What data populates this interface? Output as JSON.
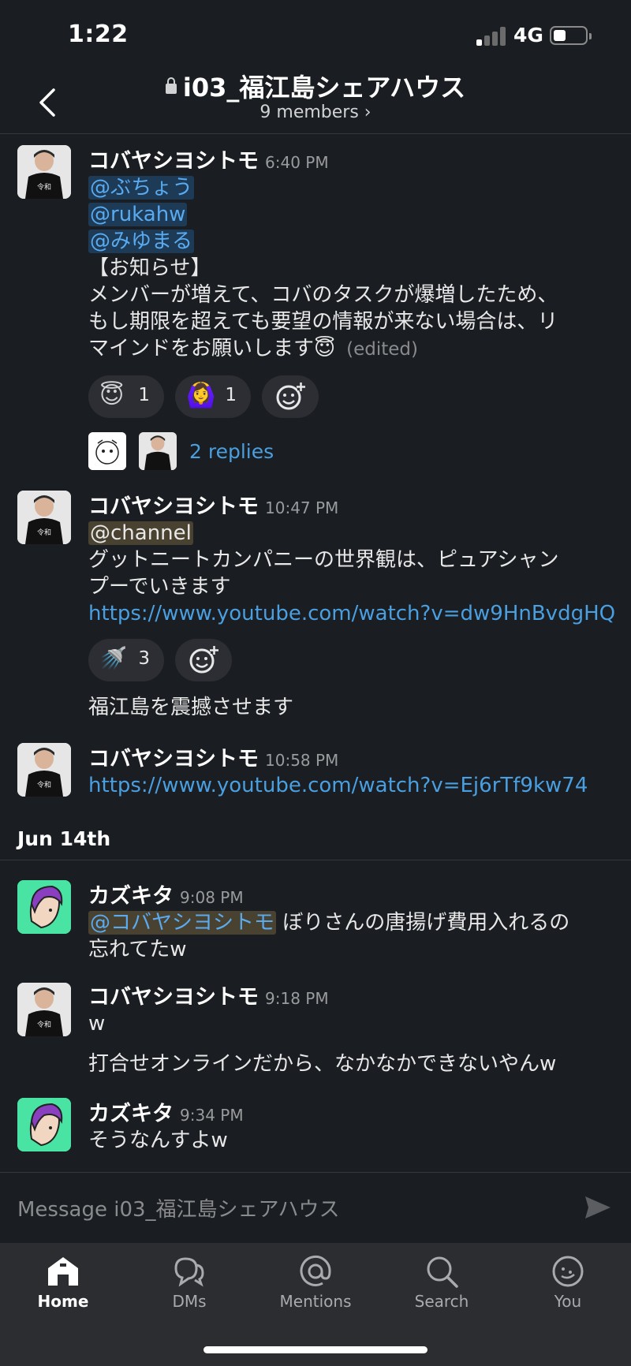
{
  "status_bar": {
    "time": "1:22",
    "network": "4G"
  },
  "header": {
    "channel": "i03_福江島シェアハウス",
    "members": "9 members ›"
  },
  "messages": [
    {
      "author": "コバヤシヨシトモ",
      "time": "6:40 PM",
      "mentions": [
        "@ぶちょう",
        "@rukahw",
        "@みゆまる"
      ],
      "lines": [
        "【お知らせ】",
        "メンバーが増えて、コバのタスクが爆増したため、",
        "もし期限を超えても要望の情報が来ない場合は、リ",
        "マインドをお願いします😇"
      ],
      "edited": "(edited)",
      "reactions": [
        {
          "emoji": "😇",
          "count": "1"
        },
        {
          "emoji": "🙆‍♀️",
          "count": "1"
        }
      ],
      "replies": "2 replies"
    },
    {
      "author": "コバヤシヨシトモ",
      "time": "10:47 PM",
      "mention": "@channel",
      "lines": [
        "グットニートカンパニーの世界観は、ピュアシャン",
        "プーでいきます"
      ],
      "link": "https://www.youtube.com/watch?v=dw9HnBvdgHQ",
      "reactions": [
        {
          "emoji": "🚿",
          "count": "3"
        }
      ],
      "followup": "福江島を震撼させます"
    },
    {
      "author": "コバヤシヨシトモ",
      "time": "10:58 PM",
      "link": "https://www.youtube.com/watch?v=Ej6rTf9kw74"
    },
    {
      "author": "カズキタ",
      "time": "9:08 PM",
      "mention": "@コバヤシヨシトモ",
      "text_after": " ぼりさんの唐揚げ費用入れるの",
      "line2": "忘れてたw"
    },
    {
      "author": "コバヤシヨシトモ",
      "time": "9:18 PM",
      "lines": [
        "w"
      ],
      "followup": "打合せオンラインだから、なかなかできないやんw"
    },
    {
      "author": "カズキタ",
      "time": "9:34 PM",
      "lines": [
        "そうなんすよw"
      ]
    }
  ],
  "date_divider": "Jun 14th",
  "composer": {
    "placeholder": "Message i03_福江島シェアハウス"
  },
  "tabs": [
    {
      "label": "Home",
      "icon": "home-icon"
    },
    {
      "label": "DMs",
      "icon": "dms-icon"
    },
    {
      "label": "Mentions",
      "icon": "at-icon"
    },
    {
      "label": "Search",
      "icon": "search-icon"
    },
    {
      "label": "You",
      "icon": "you-icon"
    }
  ],
  "colors": {
    "background": "#1a1d21",
    "link": "#4a9fe0",
    "mention_bg": "#1d3b56",
    "channel_mention_bg": "#4a4230",
    "avatar_green": "#49e3a3"
  }
}
